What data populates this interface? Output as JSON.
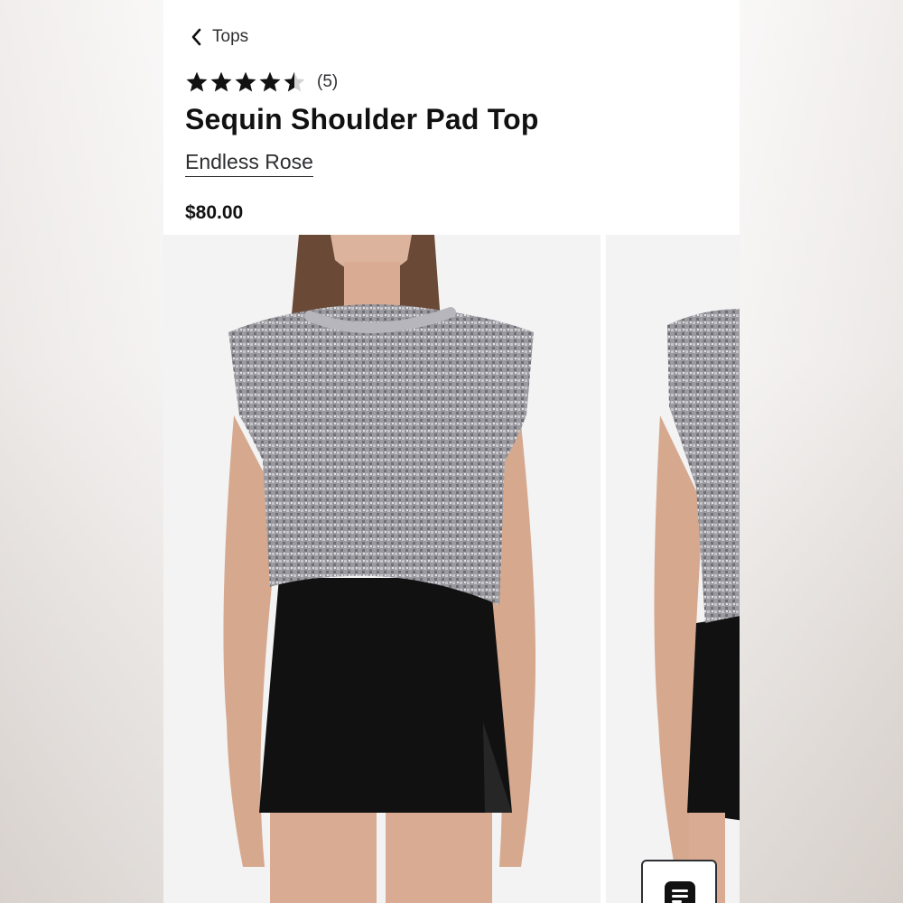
{
  "nav": {
    "back_label": "Tops"
  },
  "product": {
    "rating": 4.5,
    "rating_max": 5,
    "review_count": "(5)",
    "title": "Sequin Shoulder Pad Top",
    "brand": "Endless Rose",
    "price": "$80.00"
  },
  "gallery": {
    "images": [
      {
        "alt": "Model wearing sequin shoulder pad top, front view"
      },
      {
        "alt": "Model wearing sequin shoulder pad top, side view"
      }
    ]
  },
  "icons": {
    "back": "chevron-left-icon",
    "star": "star-icon",
    "feedback": "feedback-icon"
  },
  "colors": {
    "text_primary": "#111111",
    "text_secondary": "#2e2f32",
    "photo_background": "#f3f3f4",
    "sequin": "#9d9ca1",
    "skirt": "#111111"
  }
}
